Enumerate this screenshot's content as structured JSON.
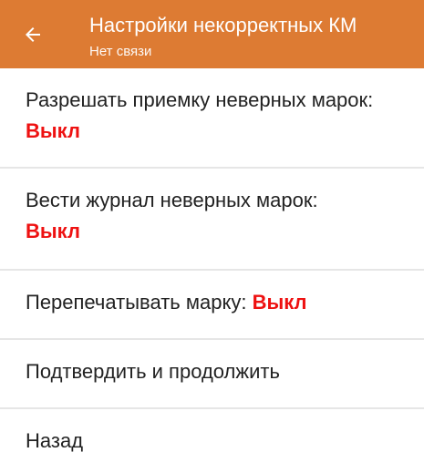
{
  "appbar": {
    "title": "Настройки некорректных КМ",
    "subtitle": "Нет связи",
    "back_icon": "arrow-left-icon",
    "color": "#dd7b33"
  },
  "menu": {
    "items": [
      {
        "label": "Разрешать приемку неверных марок: ",
        "value": "Выкл"
      },
      {
        "label": "Вести журнал неверных марок: ",
        "value": "Выкл"
      },
      {
        "label": "Перепечатывать марку: ",
        "value": "Выкл"
      },
      {
        "label": "Подтвердить и продолжить"
      },
      {
        "label": "Назад"
      }
    ],
    "value_color": "#ee1111"
  }
}
